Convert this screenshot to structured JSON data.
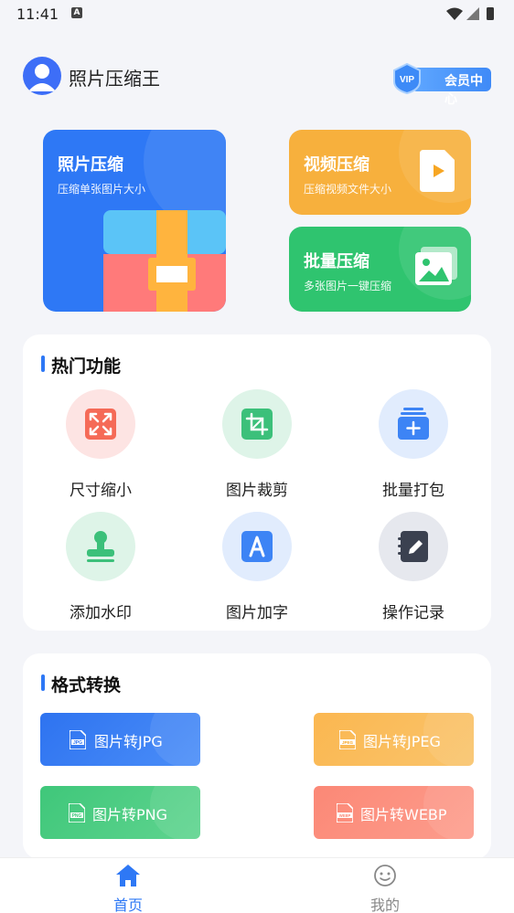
{
  "status_bar": {
    "time": "11:41"
  },
  "header": {
    "title": "照片压缩王",
    "vip_label": "会员中心",
    "vip_badge": "VIP"
  },
  "feature_cards": {
    "photo": {
      "title": "照片压缩",
      "subtitle": "压缩单张图片大小"
    },
    "video": {
      "title": "视频压缩",
      "subtitle": "压缩视频文件大小"
    },
    "batch": {
      "title": "批量压缩",
      "subtitle": "多张图片一键压缩"
    }
  },
  "hot": {
    "title": "热门功能",
    "tools": [
      {
        "label": "尺寸缩小",
        "icon": "resize-icon"
      },
      {
        "label": "图片裁剪",
        "icon": "crop-icon"
      },
      {
        "label": "批量打包",
        "icon": "batch-pack-icon"
      },
      {
        "label": "添加水印",
        "icon": "stamp-icon"
      },
      {
        "label": "图片加字",
        "icon": "text-icon"
      },
      {
        "label": "操作记录",
        "icon": "notebook-edit-icon"
      }
    ]
  },
  "format": {
    "title": "格式转换",
    "buttons": [
      {
        "label": "图片转JPG",
        "badge": "JPG"
      },
      {
        "label": "图片转JPEG",
        "badge": "JPEG"
      },
      {
        "label": "图片转PNG",
        "badge": "PNG"
      },
      {
        "label": "图片转WEBP",
        "badge": "WEBP"
      }
    ]
  },
  "nav": {
    "home": "首页",
    "mine": "我的"
  },
  "colors": {
    "primary": "#2e78f5",
    "orange": "#f7b03d",
    "green": "#2fc46f",
    "nav_active": "#2e78f5",
    "nav_inactive": "#888888"
  }
}
